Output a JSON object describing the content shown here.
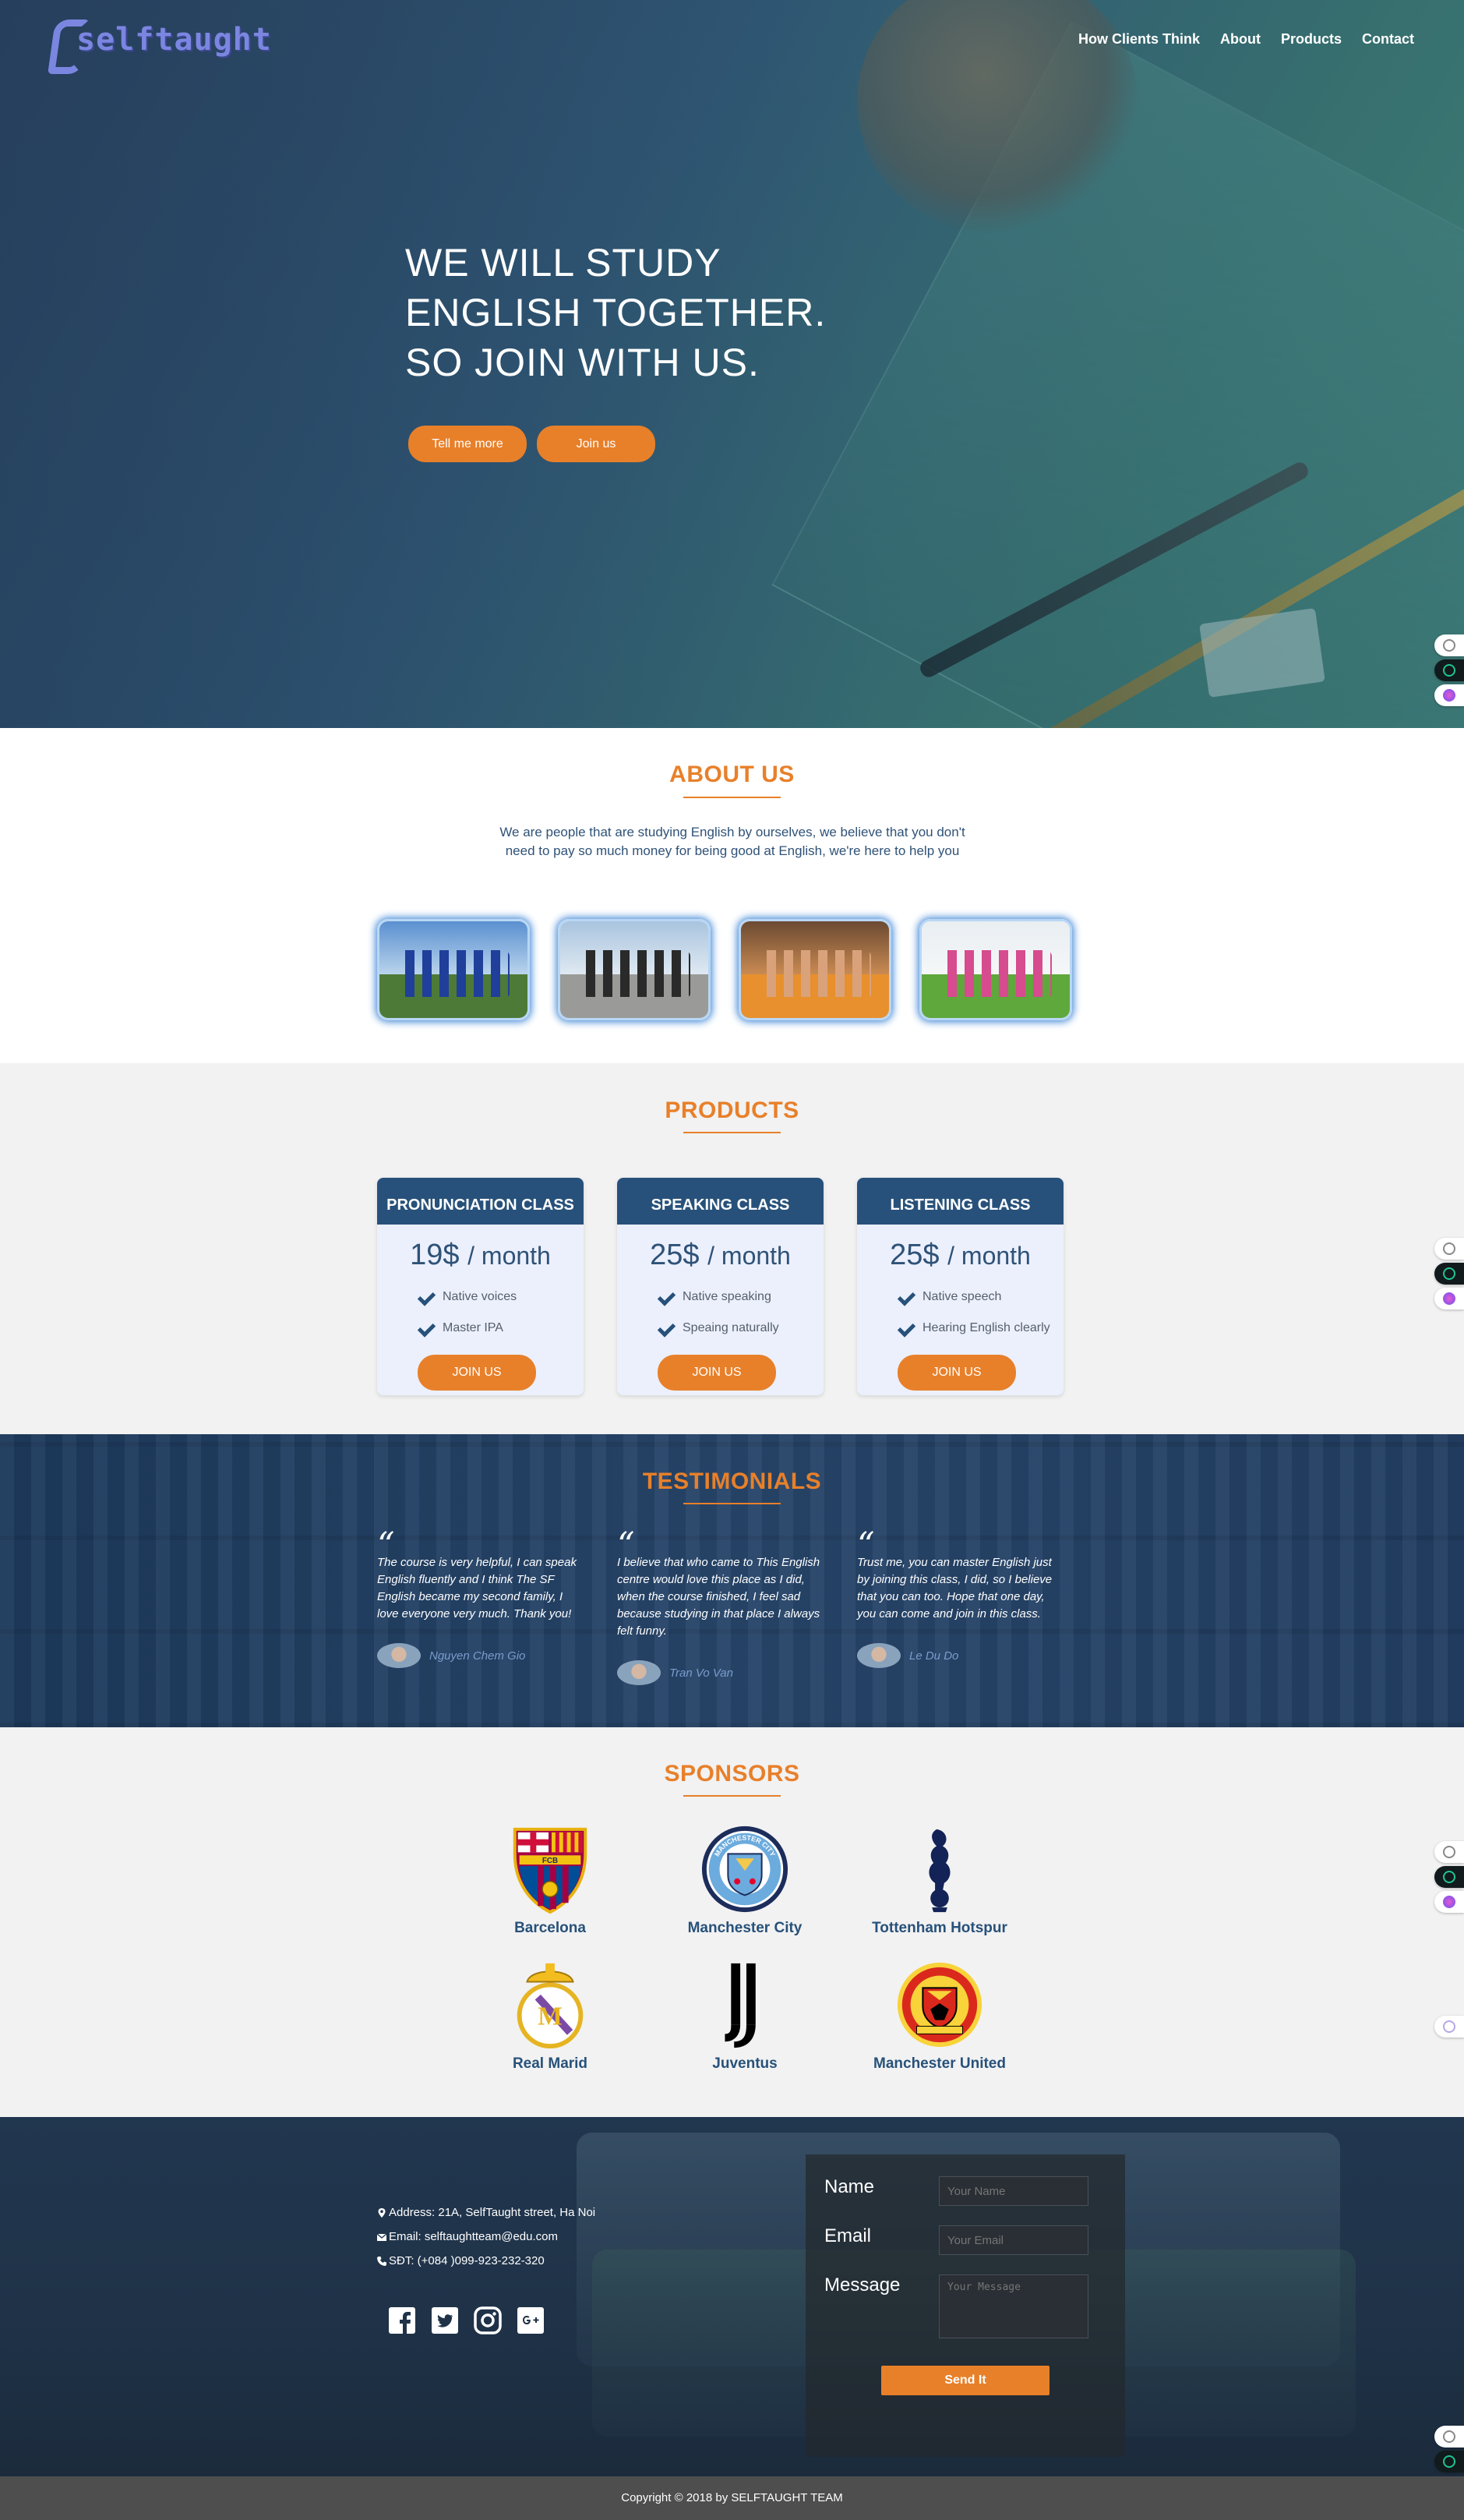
{
  "header": {
    "logo_text": "selftaught",
    "nav": [
      "How Clients Think",
      "About",
      "Products",
      "Contact"
    ]
  },
  "hero": {
    "title_lines": [
      "WE WILL STUDY",
      "ENGLISH TOGETHER.",
      "SO JOIN WITH US."
    ],
    "btn_more": "Tell me more",
    "btn_join": "Join us"
  },
  "about": {
    "title": "ABOUT US",
    "text": "We are people that are studying English by ourselves, we believe that you don't need to pay so much money for being good at English, we're here to help you"
  },
  "products": {
    "title": "PRODUCTS",
    "cards": [
      {
        "name": "PRONUNCIATION CLASS",
        "price": "19$",
        "per": "/ month",
        "features": [
          "Native voices",
          "Master IPA"
        ],
        "button": "JOIN US"
      },
      {
        "name": "SPEAKING CLASS",
        "price": "25$",
        "per": "/ month",
        "features": [
          "Native speaking",
          "Speaing naturally"
        ],
        "button": "JOIN US"
      },
      {
        "name": "LISTENING CLASS",
        "price": "25$",
        "per": "/ month",
        "features": [
          "Native speech",
          "Hearing English clearly"
        ],
        "button": "JOIN US"
      }
    ]
  },
  "testimonials": {
    "title": "TESTIMONIALS",
    "items": [
      {
        "text": "The course is very helpful, I can speak English fluently and I think The SF English became my second family, I love everyone very much. Thank you!",
        "name": "Nguyen Chem Gio"
      },
      {
        "text": "I believe that who came to This English centre would love this place as I did, when the course finished, I feel sad because studying in that place I always felt funny.",
        "name": "Tran Vo Van"
      },
      {
        "text": "Trust me, you can master English just by joining this class, I did, so I believe that you can too. Hope that one day, you can come and join in this class.",
        "name": "Le Du Do"
      }
    ]
  },
  "sponsors": {
    "title": "SPONSORS",
    "items": [
      "Barcelona",
      "Manchester City",
      "Tottenham Hotspur",
      "Real Marid",
      "Juventus",
      "Manchester United"
    ],
    "crest_text": {
      "barcelona": "FCB",
      "man_city": "MANCHESTER CITY"
    }
  },
  "footer": {
    "address": "Address: 21A, SelfTaught street, Ha Noi",
    "email": "Email: selftaughtteam@edu.com",
    "phone": "SĐT: (+084 )099-923-232-320",
    "form": {
      "name_label": "Name",
      "name_placeholder": "Your Name",
      "email_label": "Email",
      "email_placeholder": "Your Email",
      "message_label": "Message",
      "message_placeholder": "Your Message",
      "submit": "Send It"
    },
    "copyright": "Copyright © 2018 by SELFTAUGHT TEAM"
  },
  "colors": {
    "accent": "#e8802a",
    "navy": "#27517a",
    "hero": "#2f5673"
  }
}
